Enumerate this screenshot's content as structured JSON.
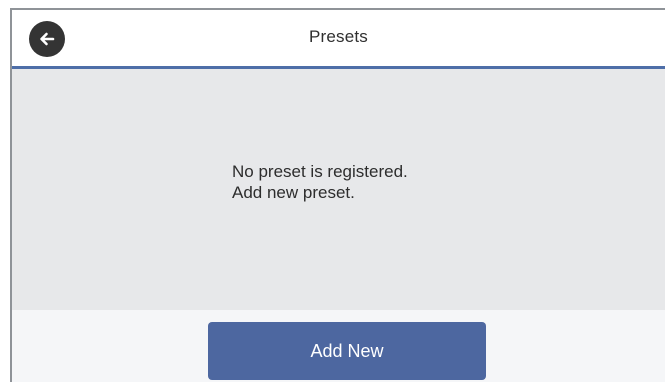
{
  "header": {
    "title": "Presets",
    "back_icon": "arrow-left-icon"
  },
  "content": {
    "message_line1": "No preset is registered.",
    "message_line2": "Add new preset."
  },
  "footer": {
    "add_new_label": "Add New"
  },
  "colors": {
    "accent": "#4e6ea8",
    "button": "#4d67a0",
    "content_background": "#e7e8ea",
    "back_button": "#343434"
  }
}
